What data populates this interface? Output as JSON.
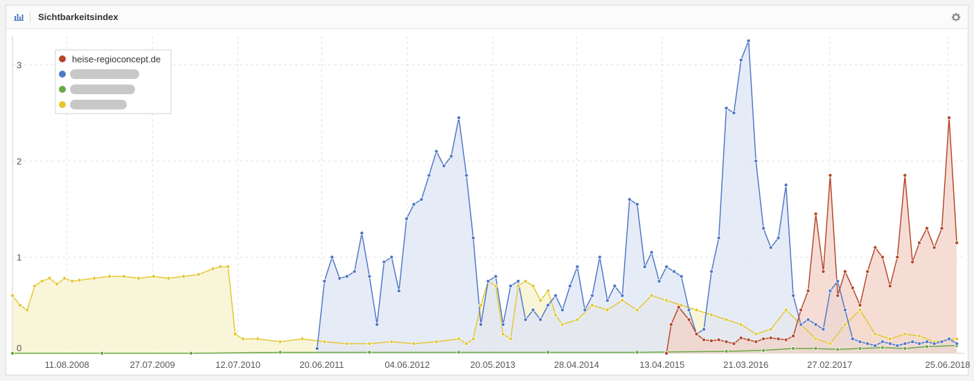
{
  "panel": {
    "title": "Sichtbarkeitsindex",
    "icon": "bar-chart-icon",
    "settings_icon": "gear-icon"
  },
  "chart_data": {
    "type": "area",
    "title": "Sichtbarkeitsindex",
    "xlabel": "",
    "ylabel": "",
    "ylim": [
      0,
      3.3
    ],
    "yticks": [
      0,
      1,
      2,
      3
    ],
    "xlim": [
      "2008-01-01",
      "2018-09-01"
    ],
    "xticks": [
      "11.08.2008",
      "27.07.2009",
      "12.07.2010",
      "20.06.2011",
      "04.06.2012",
      "20.05.2013",
      "28.04.2014",
      "13.04.2015",
      "21.03.2016",
      "27.02.2017",
      "25.06.2018"
    ],
    "grid": true,
    "legend": "top-left",
    "series": [
      {
        "name": "heise-regioconcept.de",
        "color": "#b5482a",
        "fill": "#f1d2c8",
        "x": [
          "2015-05-01",
          "2015-05-20",
          "2015-06-20",
          "2015-08-01",
          "2015-09-01",
          "2015-10-01",
          "2015-11-01",
          "2015-12-01",
          "2016-01-01",
          "2016-02-01",
          "2016-03-01",
          "2016-04-01",
          "2016-05-01",
          "2016-06-01",
          "2016-07-01",
          "2016-08-01",
          "2016-09-01",
          "2016-10-01",
          "2016-11-01",
          "2016-12-01",
          "2017-01-01",
          "2017-02-01",
          "2017-03-01",
          "2017-04-01",
          "2017-05-01",
          "2017-06-01",
          "2017-07-01",
          "2017-08-01",
          "2017-09-01",
          "2017-10-01",
          "2017-11-01",
          "2017-12-01",
          "2018-01-01",
          "2018-02-01",
          "2018-03-01",
          "2018-04-01",
          "2018-05-01",
          "2018-06-01",
          "2018-07-01",
          "2018-08-01"
        ],
        "y": [
          0.0,
          0.3,
          0.48,
          0.35,
          0.2,
          0.14,
          0.13,
          0.14,
          0.12,
          0.1,
          0.16,
          0.14,
          0.12,
          0.15,
          0.16,
          0.15,
          0.14,
          0.18,
          0.45,
          0.65,
          1.45,
          0.85,
          1.85,
          0.6,
          0.85,
          0.68,
          0.5,
          0.85,
          1.1,
          1.0,
          0.7,
          1.0,
          1.85,
          0.95,
          1.15,
          1.3,
          1.1,
          1.3,
          2.45,
          1.15
        ]
      },
      {
        "name": "",
        "color": "#4f78c5",
        "fill": "#dde4f5",
        "x": [
          "2011-06-01",
          "2011-07-01",
          "2011-08-01",
          "2011-09-01",
          "2011-10-01",
          "2011-11-01",
          "2011-12-01",
          "2012-01-01",
          "2012-02-01",
          "2012-03-01",
          "2012-04-01",
          "2012-05-01",
          "2012-06-01",
          "2012-07-01",
          "2012-08-01",
          "2012-09-01",
          "2012-10-01",
          "2012-11-01",
          "2012-12-01",
          "2013-01-01",
          "2013-02-01",
          "2013-03-01",
          "2013-04-01",
          "2013-05-01",
          "2013-06-01",
          "2013-07-01",
          "2013-08-01",
          "2013-09-01",
          "2013-10-01",
          "2013-11-01",
          "2013-12-01",
          "2014-01-01",
          "2014-02-01",
          "2014-03-01",
          "2014-04-01",
          "2014-05-01",
          "2014-06-01",
          "2014-07-01",
          "2014-08-01",
          "2014-09-01",
          "2014-10-01",
          "2014-11-01",
          "2014-12-01",
          "2015-01-01",
          "2015-02-01",
          "2015-03-01",
          "2015-04-01",
          "2015-05-01",
          "2015-06-01",
          "2015-07-01",
          "2015-08-01",
          "2015-09-01",
          "2015-10-01",
          "2015-11-01",
          "2015-12-01",
          "2016-01-01",
          "2016-02-01",
          "2016-03-01",
          "2016-04-01",
          "2016-05-01",
          "2016-06-01",
          "2016-07-01",
          "2016-08-01",
          "2016-09-01",
          "2016-10-01",
          "2016-11-01",
          "2016-12-01",
          "2017-01-01",
          "2017-02-01",
          "2017-03-01",
          "2017-04-01",
          "2017-05-01",
          "2017-06-01",
          "2017-07-01",
          "2017-08-01",
          "2017-09-01",
          "2017-10-01",
          "2017-11-01",
          "2017-12-01",
          "2018-01-01",
          "2018-02-01",
          "2018-03-01",
          "2018-04-01",
          "2018-05-01",
          "2018-06-01",
          "2018-07-01",
          "2018-08-01"
        ],
        "y": [
          0.05,
          0.75,
          1.0,
          0.78,
          0.8,
          0.85,
          1.25,
          0.8,
          0.3,
          0.95,
          1.0,
          0.65,
          1.4,
          1.55,
          1.6,
          1.85,
          2.1,
          1.95,
          2.05,
          2.45,
          1.85,
          1.2,
          0.3,
          0.75,
          0.8,
          0.3,
          0.7,
          0.75,
          0.35,
          0.45,
          0.35,
          0.5,
          0.6,
          0.45,
          0.7,
          0.9,
          0.45,
          0.6,
          1.0,
          0.55,
          0.7,
          0.6,
          1.6,
          1.55,
          0.9,
          1.05,
          0.75,
          0.9,
          0.85,
          0.8,
          0.45,
          0.2,
          0.25,
          0.85,
          1.2,
          2.55,
          2.5,
          3.05,
          3.25,
          2.0,
          1.3,
          1.1,
          1.2,
          1.75,
          0.6,
          0.3,
          0.35,
          0.3,
          0.25,
          0.65,
          0.75,
          0.45,
          0.15,
          0.12,
          0.1,
          0.08,
          0.12,
          0.1,
          0.08,
          0.1,
          0.12,
          0.1,
          0.12,
          0.1,
          0.12,
          0.15,
          0.1
        ]
      },
      {
        "name": "",
        "color": "#6aa842",
        "fill": "#cfe6bf",
        "x": [
          "2008-01-01",
          "2009-01-01",
          "2010-01-01",
          "2011-01-01",
          "2012-01-01",
          "2013-01-01",
          "2014-01-01",
          "2015-01-01",
          "2016-01-01",
          "2016-06-01",
          "2016-10-01",
          "2017-01-01",
          "2017-04-01",
          "2017-07-01",
          "2017-10-01",
          "2018-01-01",
          "2018-04-01",
          "2018-08-01"
        ],
        "y": [
          0.0,
          0.0,
          0.0,
          0.01,
          0.01,
          0.01,
          0.01,
          0.01,
          0.02,
          0.03,
          0.05,
          0.05,
          0.04,
          0.05,
          0.06,
          0.05,
          0.07,
          0.08
        ]
      },
      {
        "name": "",
        "color": "#e3c832",
        "fill": "#f7f2cc",
        "x": [
          "2008-01-01",
          "2008-02-01",
          "2008-03-01",
          "2008-04-01",
          "2008-05-01",
          "2008-06-01",
          "2008-07-01",
          "2008-08-01",
          "2008-09-01",
          "2008-10-01",
          "2008-12-01",
          "2009-02-01",
          "2009-04-01",
          "2009-06-01",
          "2009-08-01",
          "2009-10-01",
          "2009-12-01",
          "2010-02-01",
          "2010-04-01",
          "2010-05-01",
          "2010-06-01",
          "2010-07-01",
          "2010-08-01",
          "2010-10-01",
          "2011-01-01",
          "2011-04-01",
          "2011-07-01",
          "2011-10-01",
          "2012-01-01",
          "2012-04-01",
          "2012-07-01",
          "2012-10-01",
          "2013-01-01",
          "2013-02-01",
          "2013-03-01",
          "2013-04-01",
          "2013-05-01",
          "2013-06-01",
          "2013-07-01",
          "2013-08-01",
          "2013-09-01",
          "2013-10-01",
          "2013-11-01",
          "2013-12-01",
          "2014-01-01",
          "2014-02-01",
          "2014-03-01",
          "2014-05-01",
          "2014-07-01",
          "2014-09-01",
          "2014-11-01",
          "2015-01-01",
          "2015-03-01",
          "2015-05-01",
          "2015-07-01",
          "2015-09-01",
          "2015-11-01",
          "2016-01-01",
          "2016-03-01",
          "2016-05-01",
          "2016-07-01",
          "2016-09-01",
          "2016-11-01",
          "2017-01-01",
          "2017-03-01",
          "2017-05-01",
          "2017-07-01",
          "2017-09-01",
          "2017-11-01",
          "2018-01-01",
          "2018-03-01",
          "2018-05-01",
          "2018-08-01"
        ],
        "y": [
          0.6,
          0.5,
          0.45,
          0.7,
          0.75,
          0.78,
          0.72,
          0.78,
          0.75,
          0.76,
          0.78,
          0.8,
          0.8,
          0.78,
          0.8,
          0.78,
          0.8,
          0.82,
          0.88,
          0.9,
          0.9,
          0.2,
          0.15,
          0.15,
          0.12,
          0.15,
          0.12,
          0.1,
          0.1,
          0.12,
          0.1,
          0.12,
          0.15,
          0.1,
          0.15,
          0.5,
          0.75,
          0.7,
          0.2,
          0.15,
          0.7,
          0.75,
          0.7,
          0.55,
          0.65,
          0.4,
          0.3,
          0.35,
          0.5,
          0.45,
          0.55,
          0.45,
          0.6,
          0.55,
          0.5,
          0.45,
          0.4,
          0.35,
          0.3,
          0.2,
          0.25,
          0.45,
          0.3,
          0.15,
          0.1,
          0.3,
          0.45,
          0.2,
          0.15,
          0.2,
          0.18,
          0.12,
          0.15
        ]
      }
    ]
  }
}
